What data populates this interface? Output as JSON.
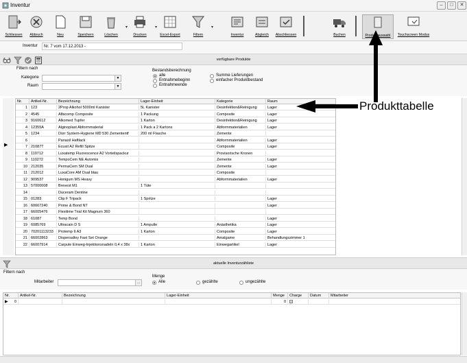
{
  "window": {
    "title": "Inventur"
  },
  "toolbar": {
    "buttons": [
      {
        "label": "Schliessen"
      },
      {
        "label": "Abbruch"
      },
      {
        "label": "Neu"
      },
      {
        "label": "Speichern"
      },
      {
        "label": "Löschen"
      },
      {
        "label": "Drucken"
      },
      {
        "label": "Excel-Export"
      },
      {
        "label": "Filtern"
      },
      {
        "label": "Inventur"
      },
      {
        "label": "Abgleich"
      },
      {
        "label": "Abschliessen"
      },
      {
        "label": "Buchen"
      },
      {
        "label": "Produktauswahl"
      },
      {
        "label": "Touchscreen Modus"
      }
    ]
  },
  "inventur": {
    "label": "Inventur",
    "value": "Nr. 7 vom 17.12.2013 -"
  },
  "products_panel": {
    "caption": "verfügbare Produkte",
    "filter_title": "Filtern nach",
    "kategorie_label": "Kategorie",
    "raum_label": "Raum",
    "bestand_title": "Bestandsberechnung",
    "radio_alle": "alle",
    "radio_entnahmebeginn": "Entnahmebeginn",
    "radio_entnahmeende": "Entnahmeende",
    "radio_summe": "Summe Lieferungen",
    "radio_einfacher": "einfacher Produktbestand"
  },
  "product_table": {
    "columns": [
      "Nr.",
      "Artikel-Nr.",
      "Bezeichnung",
      "Lager-Einheit",
      "Kategorie",
      "Raum"
    ],
    "rows": [
      [
        "1",
        "123",
        "2Prop Alkohol 5000ml Kanister",
        "5L Kanister",
        "Desinfektion&Reinigung",
        "Lager"
      ],
      [
        "2",
        "4545",
        "Alfacomp Composite",
        "1 Packung",
        "Composite",
        "Lager"
      ],
      [
        "3",
        "9160612",
        "Alkomed Tupfer",
        "1 Karton",
        "Desinfektion&Reinigung",
        "Lager"
      ],
      [
        "4",
        "12355A",
        "Alginoplast Abformmaterial",
        "1 Pack a 2 Kartons",
        "Abformmaterialien",
        "Lager"
      ],
      [
        "5",
        "1234",
        "Dürr System-Hygiene MD 530 Zemententf",
        "200 ml Flasche",
        "Zemente",
        ""
      ],
      [
        "6",
        "",
        "Panasil Haftlack",
        "",
        "Abformmaterialien",
        "Lager"
      ],
      [
        "7",
        "21087T",
        "Ecusit A2 Refill Spitze",
        "",
        "Composite",
        "Lager"
      ],
      [
        "8",
        "110712",
        "Luxatemp Fluorescence A2 Vorteilspackur",
        "",
        "Provisorische Kronen",
        ""
      ],
      [
        "9",
        "110272",
        "TempoCem NE Automix",
        "",
        "Zemente",
        "Lager"
      ],
      [
        "10",
        "212035",
        "PermaCem SM Dual",
        "",
        "Zemente",
        "Lager"
      ],
      [
        "11",
        "212012",
        "LuxaCore AM Dual blau",
        "",
        "Composite",
        ""
      ],
      [
        "12",
        "909537",
        "Honigum MS Heavy",
        "",
        "Abformmaterialien",
        "Lager"
      ],
      [
        "13",
        "57000008",
        "Brevest M1",
        "1 Tüte",
        "",
        ""
      ],
      [
        "14",
        "",
        "Duceram Dentine",
        "",
        "",
        ""
      ],
      [
        "15",
        "01283",
        "Clip F Tripack",
        "1 Spritze",
        "",
        "Lager"
      ],
      [
        "16",
        "60667240",
        "Prime & Bond NT",
        "",
        "",
        "Lager"
      ],
      [
        "17",
        "66005476",
        "Flexitime Trial Kit Magnum 360",
        "",
        "",
        ""
      ],
      [
        "18",
        "61087",
        "Temp Bond",
        "",
        "",
        "Lager"
      ],
      [
        "19",
        "6085769",
        "Ultracain D S",
        "1 Ampulle",
        "Anästhetika",
        "Lager"
      ],
      [
        "20",
        "70201113233",
        "Protemp II A3",
        "1 Karton",
        "Composite",
        "Lager"
      ],
      [
        "21",
        "66002863",
        "Dispersalloy Fast Set Orange",
        "",
        "Amalgame",
        "Behandlungszimmer 1"
      ],
      [
        "22",
        "66007914",
        "Carpule Einweg-Injektionsnadeln 0,4 x 38x",
        "1 Karton",
        "Einwegartikel",
        "Lager"
      ]
    ]
  },
  "annotation": {
    "label": "Produkttabelle"
  },
  "counts_panel": {
    "caption": "aktuelle Inventurzähliste",
    "filter_title": "Filtern nach",
    "mitarbeiter_label": "Mitarbeiter",
    "menge_title": "Menge",
    "radio_alle": "Alle",
    "radio_gezaehlte": "gezählte",
    "radio_ungezaehlte": "ungezählte"
  },
  "count_table": {
    "columns": [
      "Nr.",
      "Artikel-Nr.",
      "Bezeichnung",
      "Lager-Einheit",
      "Menge",
      "Charge",
      "Datum",
      "Mitarbeiter"
    ],
    "rows": [
      [
        "0",
        "",
        "",
        "",
        "0",
        "",
        "",
        ""
      ]
    ]
  }
}
